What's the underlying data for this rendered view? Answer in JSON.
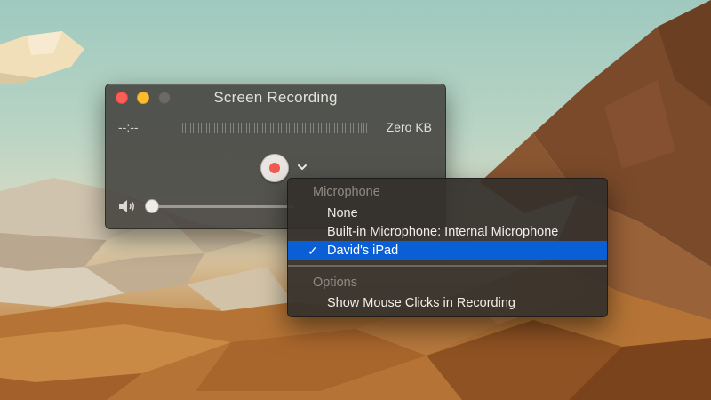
{
  "window": {
    "title": "Screen Recording",
    "time": "--:--",
    "file_size": "Zero KB",
    "volume_level": 0.0
  },
  "menu": {
    "sections": [
      {
        "header": "Microphone",
        "items": [
          {
            "label": "None",
            "checked": false
          },
          {
            "label": "Built-in Microphone: Internal Microphone",
            "checked": false
          },
          {
            "label": "David's iPad",
            "checked": true
          }
        ]
      },
      {
        "header": "Options",
        "items": [
          {
            "label": "Show Mouse Clicks in Recording",
            "checked": false
          }
        ]
      }
    ],
    "checkmark": "✓"
  },
  "colors": {
    "close": "#fc5f57",
    "minimize": "#fdbc2e",
    "record": "#f05a50",
    "selection": "#0b5fd6"
  },
  "icons": {
    "record": "record-icon",
    "chevron": "chevron-down-icon",
    "volume": "speaker-icon"
  }
}
